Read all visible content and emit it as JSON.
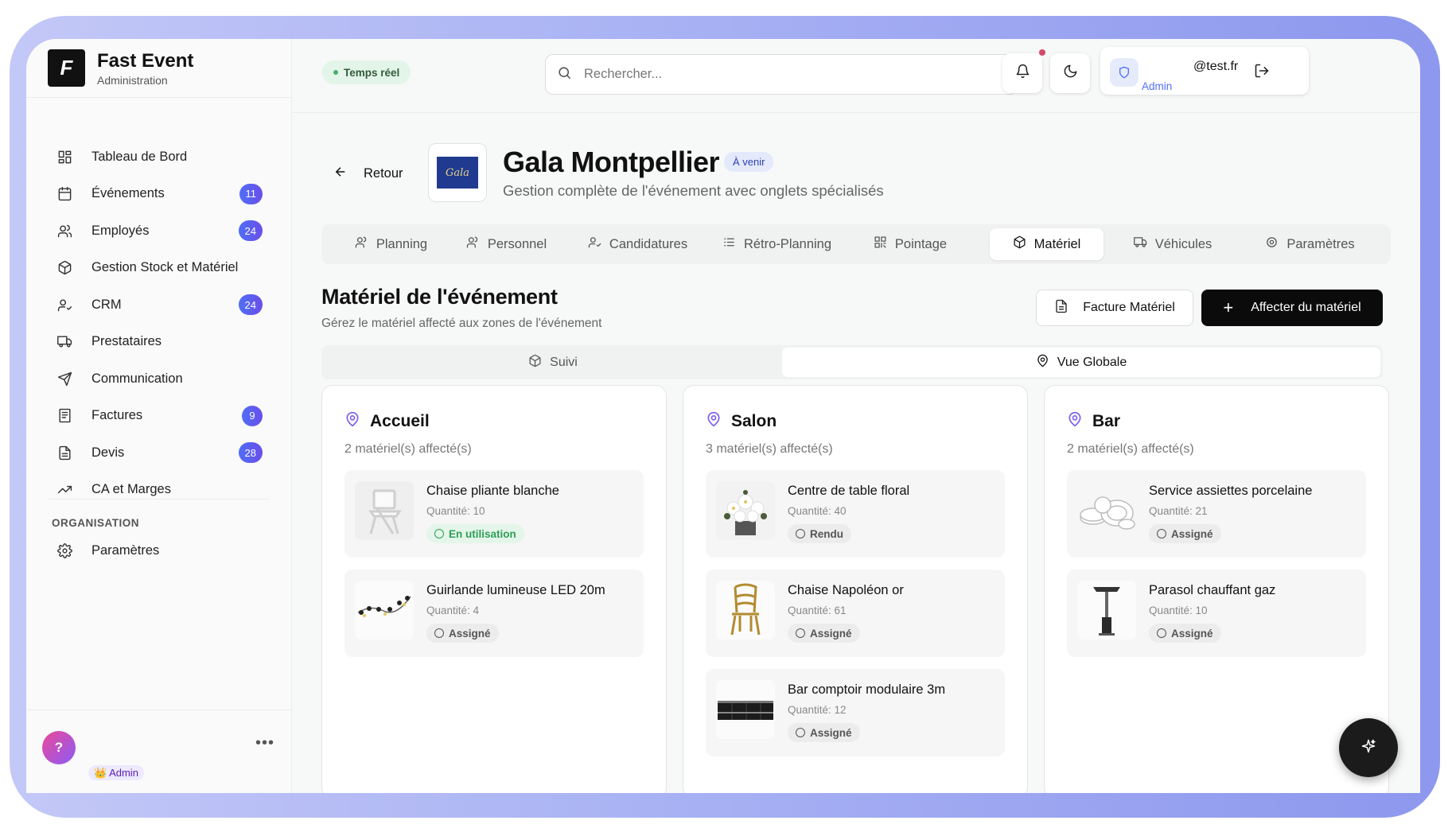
{
  "brand": {
    "name": "Fast Event",
    "subtitle": "Administration",
    "logo_letter": "F"
  },
  "sidebar": {
    "items": [
      {
        "label": "Tableau de Bord",
        "icon": "dashboard-icon",
        "badge": null
      },
      {
        "label": "Événements",
        "icon": "calendar-icon",
        "badge": "11"
      },
      {
        "label": "Employés",
        "icon": "users-icon",
        "badge": "24"
      },
      {
        "label": "Gestion Stock et Matériel",
        "icon": "box-icon",
        "badge": null
      },
      {
        "label": "CRM",
        "icon": "user-check-icon",
        "badge": "24"
      },
      {
        "label": "Prestataires",
        "icon": "truck-icon",
        "badge": null
      },
      {
        "label": "Communication",
        "icon": "send-icon",
        "badge": null
      },
      {
        "label": "Factures",
        "icon": "receipt-icon",
        "badge": "9"
      },
      {
        "label": "Devis",
        "icon": "document-icon",
        "badge": "28"
      },
      {
        "label": "CA et Marges",
        "icon": "trending-up-icon",
        "badge": null
      }
    ],
    "section_title": "ORGANISATION",
    "org_items": [
      {
        "label": "Paramètres",
        "icon": "gear-icon"
      }
    ],
    "help_label": "?",
    "role_chip": "👑 Admin",
    "more_label": "•••"
  },
  "topbar": {
    "live_label": "Temps réel",
    "search_placeholder": "Rechercher...",
    "user_role": "Admin",
    "user_email": "@test.fr"
  },
  "event": {
    "back_label": "Retour",
    "thumb_text": "Gala",
    "title": "Gala Montpellier",
    "status": "À venir",
    "subtitle": "Gestion complète de l'événement avec onglets spécialisés"
  },
  "tabs": [
    {
      "label": "Planning",
      "icon": "users-icon",
      "active": false
    },
    {
      "label": "Personnel",
      "icon": "users-icon",
      "active": false
    },
    {
      "label": "Candidatures",
      "icon": "user-check-icon",
      "active": false
    },
    {
      "label": "Rétro-Planning",
      "icon": "list-icon",
      "active": false
    },
    {
      "label": "Pointage",
      "icon": "qr-icon",
      "active": false
    },
    {
      "label": "Matériel",
      "icon": "box-icon",
      "active": true
    },
    {
      "label": "Véhicules",
      "icon": "truck-icon",
      "active": false
    },
    {
      "label": "Paramètres",
      "icon": "gear-icon",
      "active": false
    }
  ],
  "section": {
    "title": "Matériel de l'événement",
    "subtitle": "Gérez le matériel affecté aux zones de l'événement",
    "invoice_button": "Facture Matériel",
    "assign_button": "Affecter du matériel"
  },
  "subtabs": [
    {
      "label": "Suivi",
      "icon": "box-icon",
      "active": false
    },
    {
      "label": "Vue Globale",
      "icon": "map-pin-icon",
      "active": true
    }
  ],
  "zones": [
    {
      "name": "Accueil",
      "count": "2 matériel(s) affecté(s)",
      "items": [
        {
          "name": "Chaise pliante blanche",
          "qty": "Quantité: 10",
          "status": "En utilisation",
          "status_kind": "green",
          "image": "white-chair"
        },
        {
          "name": "Guirlande lumineuse LED 20m",
          "qty": "Quantité: 4",
          "status": "Assigné",
          "status_kind": "gray",
          "image": "led-garland"
        }
      ]
    },
    {
      "name": "Salon",
      "count": "3 matériel(s) affecté(s)",
      "items": [
        {
          "name": "Centre de table floral",
          "qty": "Quantité: 40",
          "status": "Rendu",
          "status_kind": "gray",
          "image": "flowers"
        },
        {
          "name": "Chaise Napoléon or",
          "qty": "Quantité: 61",
          "status": "Assigné",
          "status_kind": "gray",
          "image": "gold-chair"
        },
        {
          "name": "Bar comptoir modulaire 3m",
          "qty": "Quantité: 12",
          "status": "Assigné",
          "status_kind": "gray",
          "image": "bar-counter"
        }
      ]
    },
    {
      "name": "Bar",
      "count": "2 matériel(s) affecté(s)",
      "items": [
        {
          "name": "Service assiettes porcelaine",
          "qty": "Quantité: 21",
          "status": "Assigné",
          "status_kind": "gray",
          "image": "plates"
        },
        {
          "name": "Parasol chauffant gaz",
          "qty": "Quantité: 10",
          "status": "Assigné",
          "status_kind": "gray",
          "image": "heater"
        }
      ]
    }
  ],
  "colors": {
    "accent": "#4f6ef7",
    "badge_end": "#6a4ee9",
    "zone_pin": "#7b5cf0",
    "dark_button": "#0b0b0b"
  }
}
